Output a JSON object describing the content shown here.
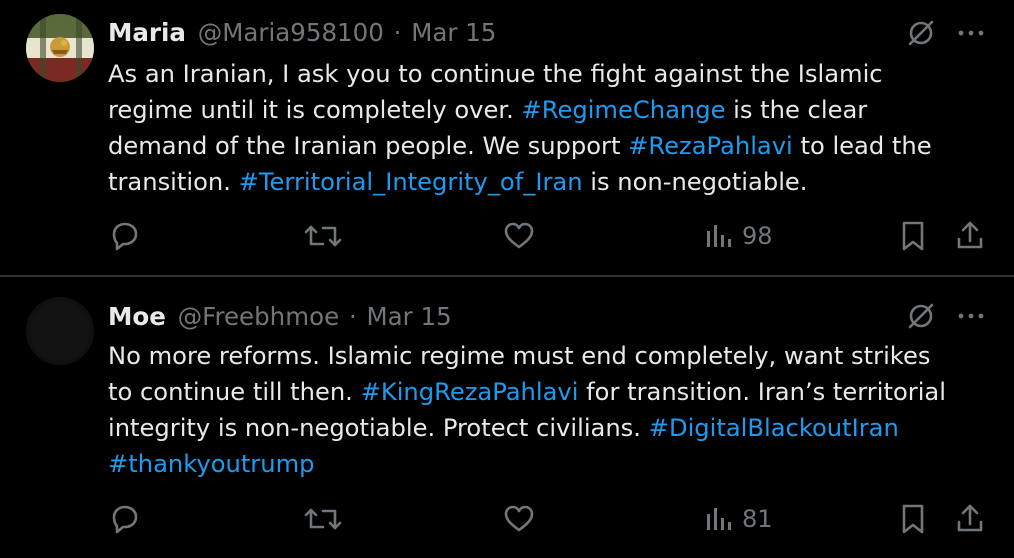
{
  "colors": {
    "background": "#000000",
    "text": "#e7e9ea",
    "muted": "#71767b",
    "link": "#1d9bf0",
    "divider": "#2f3336"
  },
  "tweets": [
    {
      "display_name": "Maria",
      "handle": "@Maria958100",
      "separator": "·",
      "time": "Mar 15",
      "avatar_icon": "profile-photo",
      "lines": [
        [
          {
            "text": "As an Iranian, I ask you to continue the fight against the Islamic",
            "hashtag": false
          }
        ],
        [
          {
            "text": "regime until it is completely over. ",
            "hashtag": false
          },
          {
            "text": "#RegimeChange",
            "hashtag": true
          },
          {
            "text": " is the clear",
            "hashtag": false
          }
        ],
        [
          {
            "text": "demand of the Iranian people. We support ",
            "hashtag": false
          },
          {
            "text": "#RezaPahlavi",
            "hashtag": true
          },
          {
            "text": " to lead the",
            "hashtag": false
          }
        ],
        [
          {
            "text": "transition. ",
            "hashtag": false
          },
          {
            "text": "#Territorial_Integrity_of_Iran",
            "hashtag": true
          },
          {
            "text": " is non-negotiable.",
            "hashtag": false
          }
        ]
      ],
      "views": "98",
      "action_icons": [
        "reply-icon",
        "retweet-icon",
        "like-icon",
        "views-icon",
        "bookmark-icon",
        "share-icon"
      ]
    },
    {
      "display_name": "Moe",
      "handle": "@Freebhmoe",
      "separator": "·",
      "time": "Mar 15",
      "avatar_icon": "profile-photo",
      "lines": [
        [
          {
            "text": "No more reforms. Islamic regime must end completely, want strikes",
            "hashtag": false
          }
        ],
        [
          {
            "text": "to continue till then. ",
            "hashtag": false
          },
          {
            "text": "#KingRezaPahlavi",
            "hashtag": true
          },
          {
            "text": " for transition. Iran’s territorial",
            "hashtag": false
          }
        ],
        [
          {
            "text": "integrity is non-negotiable. Protect civilians. ",
            "hashtag": false
          },
          {
            "text": "#DigitalBlackoutIran",
            "hashtag": true
          }
        ],
        [
          {
            "text": "#thankyoutrump",
            "hashtag": true
          }
        ]
      ],
      "views": "81",
      "action_icons": [
        "reply-icon",
        "retweet-icon",
        "like-icon",
        "views-icon",
        "bookmark-icon",
        "share-icon"
      ]
    }
  ]
}
